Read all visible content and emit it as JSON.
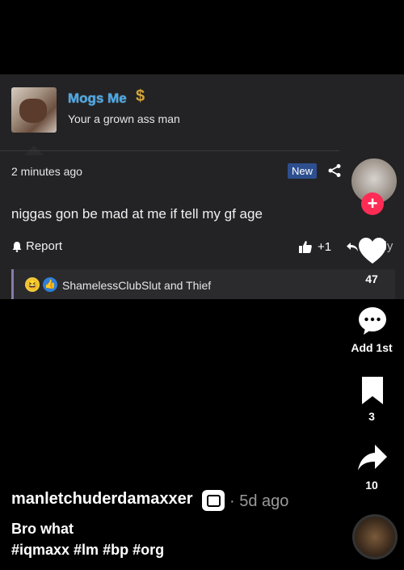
{
  "comment_card": {
    "username": "Mogs Me",
    "username_badge": "$",
    "bio": "Your a grown ass man",
    "time_ago": "2 minutes ago",
    "new_badge": "New",
    "comment_text": "niggas gon be mad at me if tell my gf age",
    "report_label": "Report",
    "like_count": "+1",
    "reply_label": "Reply",
    "reactors_text": "ShamelessClubSlut and Thief"
  },
  "rail": {
    "likes": "47",
    "comments": "Add 1st",
    "saves": "3",
    "shares": "10",
    "follow_symbol": "+"
  },
  "post": {
    "author": "manletchuderdamaxxer",
    "posted": "· 5d ago",
    "caption": "Bro what",
    "hashtags": "#iqmaxx #lm #bp #org"
  },
  "colors": {
    "accent_red": "#fe2c55",
    "username_blue": "#4aa8e6",
    "new_badge_bg": "#2d4f8f"
  },
  "icons": [
    "avatar",
    "dollar-icon",
    "share-icon",
    "bell-icon",
    "thumbs-up-icon",
    "reply-icon",
    "laugh-emoji-icon",
    "heart-icon",
    "comment-icon",
    "bookmark-icon",
    "share-arrow-icon",
    "music-disc-icon"
  ]
}
